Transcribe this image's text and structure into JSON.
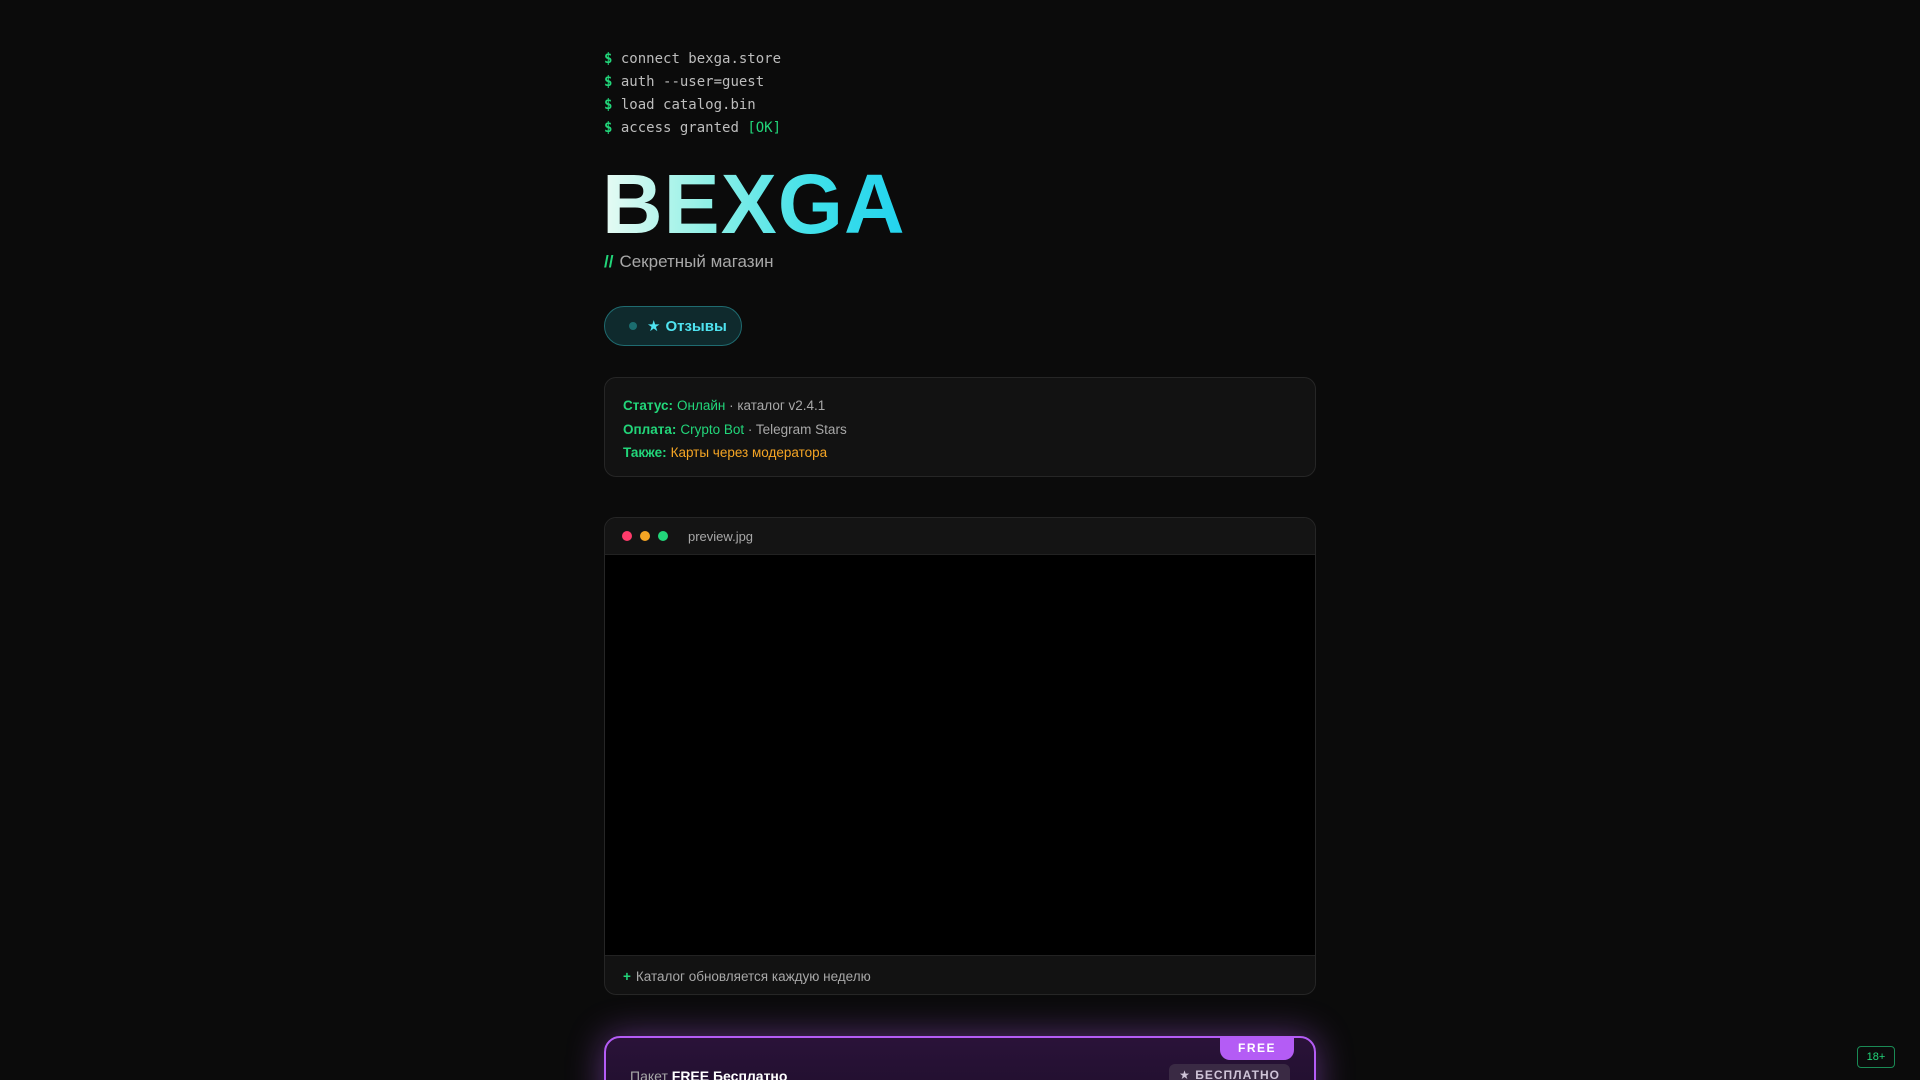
{
  "terminal": {
    "prompt": "$",
    "lines": [
      {
        "text": "connect bexga.store"
      },
      {
        "text": "auth --user=guest"
      },
      {
        "text": "load catalog.bin"
      },
      {
        "text": "access granted ",
        "ok": "[OK]"
      }
    ]
  },
  "brand": {
    "logo": "BEXGA",
    "subtitle_prefix": "//",
    "subtitle": "Секретный магазин"
  },
  "reviews_button": {
    "star": "★",
    "label": "Отзывы"
  },
  "info": {
    "status_key": "Статус:",
    "status_value": "Онлайн",
    "status_sep": " · ",
    "catalog_version": "каталог v2.4.1",
    "payment_key": "Оплата:",
    "payment_primary": "Crypto Bot",
    "payment_sep": " · ",
    "payment_secondary": "Telegram Stars",
    "also_key": "Также:",
    "also_value": "Карты через модератора"
  },
  "preview": {
    "filename": "preview.jpg",
    "caption_prefix": "+",
    "caption": "Каталог обновляется каждую неделю",
    "window_dots": [
      "#ff3b6b",
      "#f5a524",
      "#22d67a"
    ]
  },
  "package": {
    "ribbon": "FREE",
    "title_prefix": "Пакет ",
    "title_bold": "FREE Бесплатно",
    "badge": "★ БЕСПЛАТНО"
  },
  "age_badge": "18+",
  "colors": {
    "accent_green": "#22d67a",
    "accent_cyan": "#22d3ee",
    "accent_orange": "#f5a524",
    "accent_purple": "#b45cf5",
    "background": "#0b0b0b"
  }
}
